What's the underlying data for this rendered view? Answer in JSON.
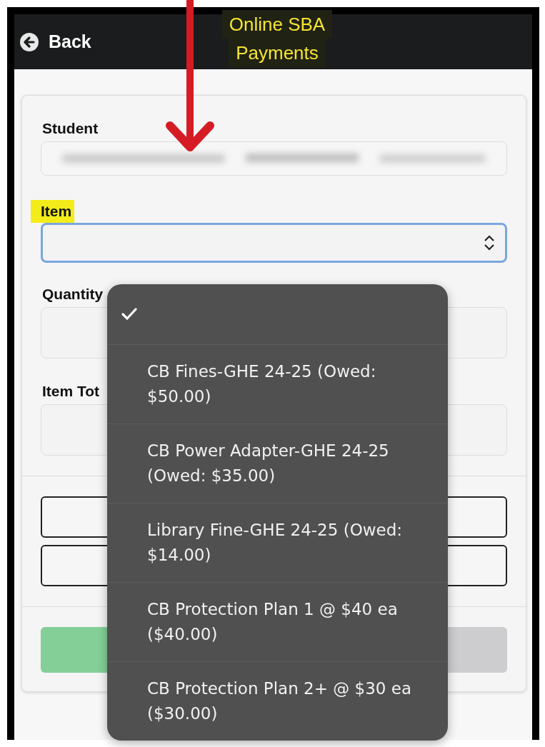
{
  "header": {
    "back_label": "Back",
    "title_lines": [
      "Online SBA",
      "Payments"
    ]
  },
  "form": {
    "fields": [
      {
        "label": "Student",
        "kind": "blurred",
        "highlighted": false
      },
      {
        "label": "Item",
        "kind": "select",
        "highlighted": true
      },
      {
        "label": "Quantity",
        "kind": "input",
        "highlighted": false
      },
      {
        "label": "Item Tot",
        "kind": "input",
        "highlighted": false
      }
    ],
    "buttons": [
      {
        "kind": "outline"
      },
      {
        "kind": "outline"
      }
    ],
    "actions": [
      {
        "kind": "primary"
      },
      {
        "kind": "secondary"
      }
    ]
  },
  "menu": {
    "options": [
      {
        "selected": true
      },
      {
        "label": "CB Fines-GHE 24-25 (Owed: $50.00)",
        "selected": false
      },
      {
        "label": "CB Power Adapter-GHE 24-25 (Owed: $35.00)",
        "selected": false
      },
      {
        "label": "Library Fine-GHE 24-25 (Owed: $14.00)",
        "selected": false
      },
      {
        "label": "CB Protection Plan 1 @ $40 ea ($40.00)",
        "selected": false
      },
      {
        "label": "CB Protection Plan 2+ @ $30 ea ($30.00)",
        "selected": false
      }
    ]
  }
}
